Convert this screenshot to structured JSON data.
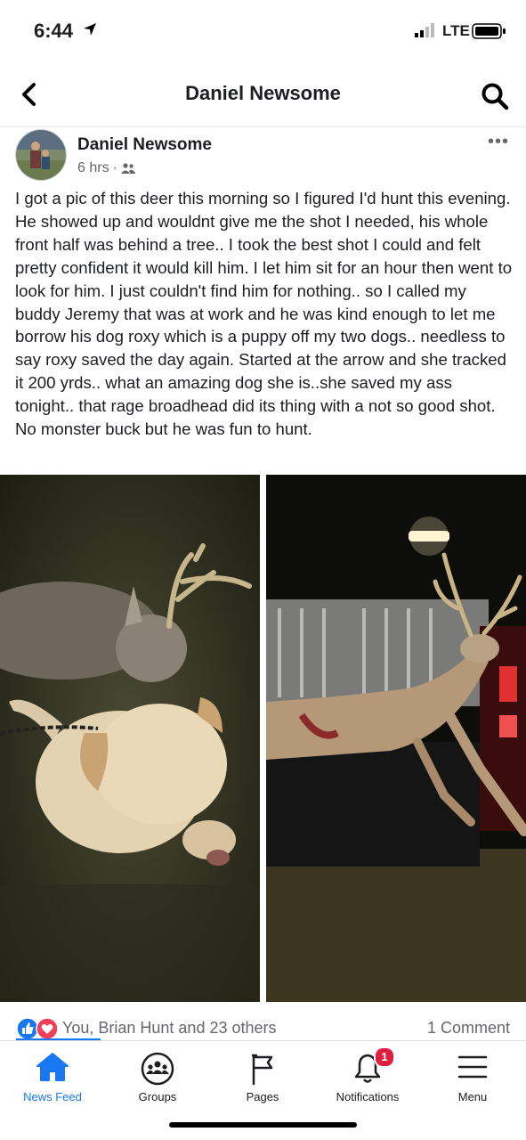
{
  "status_bar": {
    "time": "6:44",
    "network": "LTE"
  },
  "header": {
    "title": "Daniel Newsome",
    "back_icon": "chevron-left-icon",
    "search_icon": "search-icon"
  },
  "post": {
    "author": "Daniel Newsome",
    "time": "6 hrs",
    "separator": "·",
    "audience_icon": "friends-icon",
    "text": "I got a pic of this deer this morning so I figured I'd hunt this evening. He showed up and wouldnt give me the shot I needed, his whole front half was behind a tree.. I took the best shot I could and felt pretty confident it would kill him. I let him sit for an hour then went to look for him. I just couldn't find him for nothing.. so I called my buddy Jeremy that was at work and he was kind enough to let me borrow his dog roxy which is a puppy off my two dogs.. needless to say roxy saved the day again. Started at the arrow and she tracked it 200 yrds.. what an amazing dog she is..she saved my ass tonight.. that rage broadhead did its thing with a not so good shot. No monster buck but he was fun to hunt.",
    "more_icon": "more-options-icon"
  },
  "reactions": {
    "summary": "You, Brian Hunt and 23 others",
    "comments": "1 Comment",
    "icons": [
      "like-icon",
      "love-icon"
    ]
  },
  "tabbar": {
    "items": [
      {
        "label": "News Feed",
        "icon": "home-icon",
        "active": true
      },
      {
        "label": "Groups",
        "icon": "groups-icon"
      },
      {
        "label": "Pages",
        "icon": "flag-icon"
      },
      {
        "label": "Notifications",
        "icon": "bell-icon",
        "badge": "1"
      },
      {
        "label": "Menu",
        "icon": "menu-icon"
      }
    ]
  },
  "colors": {
    "accent": "#1877f2",
    "badge": "#e41e3f",
    "love": "#f33e58"
  }
}
